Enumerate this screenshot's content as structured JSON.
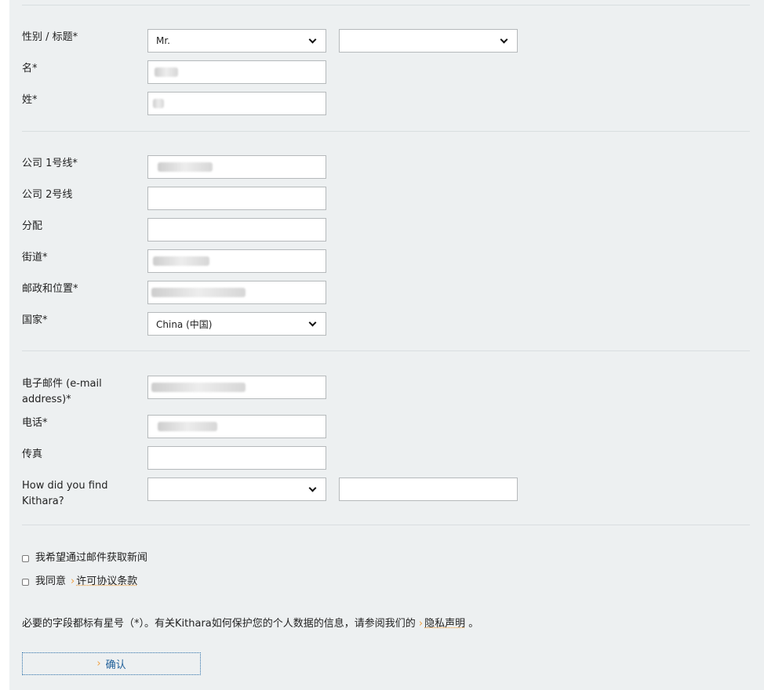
{
  "personal": {
    "salutation_label": "性别 / 标题*",
    "salutation_value": "Mr.",
    "title_value": "",
    "firstname_label": "名*",
    "lastname_label": "姓*"
  },
  "company": {
    "line1_label": "公司 1号线*",
    "line2_label": "公司 2号线",
    "department_label": "分配",
    "street_label": "街道*",
    "postal_label": "邮政和位置*",
    "country_label": "国家*",
    "country_value": "China (中国)"
  },
  "contact": {
    "email_label": "电子邮件 (e-mail address)*",
    "phone_label": "电话*",
    "fax_label": "传真",
    "found_label": "How did you find Kithara?",
    "found_value": "",
    "found_other_value": ""
  },
  "options": {
    "newsletter_label": "我希望通过邮件获取新闻",
    "agree_prefix": "我同意",
    "license_link": "许可协议条款"
  },
  "footer": {
    "note_text": "必要的字段都标有星号（*）。有关Kithara如何保护您的个人数据的信息，请参阅我们的",
    "privacy_link": "隐私声明",
    "note_suffix": "。",
    "confirm_label": "确认",
    "arrow_glyph": "›"
  }
}
